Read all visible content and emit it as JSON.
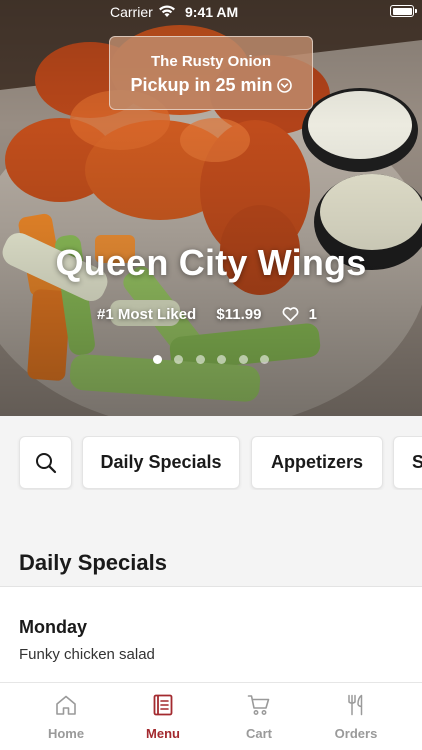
{
  "status_bar": {
    "carrier": "Carrier",
    "time": "9:41 AM"
  },
  "pickup": {
    "restaurant": "The Rusty Onion",
    "pickup_text": "Pickup in 25 min"
  },
  "hero": {
    "title": "Queen City Wings",
    "badge": "#1 Most Liked",
    "price": "$11.99",
    "likes": "1",
    "carousel_pages": 6,
    "carousel_active": 1
  },
  "chips": {
    "search_icon": "search-icon",
    "items": [
      "Daily Specials",
      "Appetizers",
      "S"
    ]
  },
  "section": {
    "title": "Daily Specials",
    "items": [
      {
        "day": "Monday",
        "description": "Funky chicken salad"
      }
    ]
  },
  "tab_bar": {
    "tabs": [
      {
        "label": "Home",
        "icon": "home-icon"
      },
      {
        "label": "Menu",
        "icon": "menu-icon"
      },
      {
        "label": "Cart",
        "icon": "cart-icon"
      },
      {
        "label": "Orders",
        "icon": "orders-icon"
      }
    ],
    "active_tab": "Menu"
  },
  "colors": {
    "accent": "#a32a2f",
    "inactive": "#9a9a9a"
  }
}
